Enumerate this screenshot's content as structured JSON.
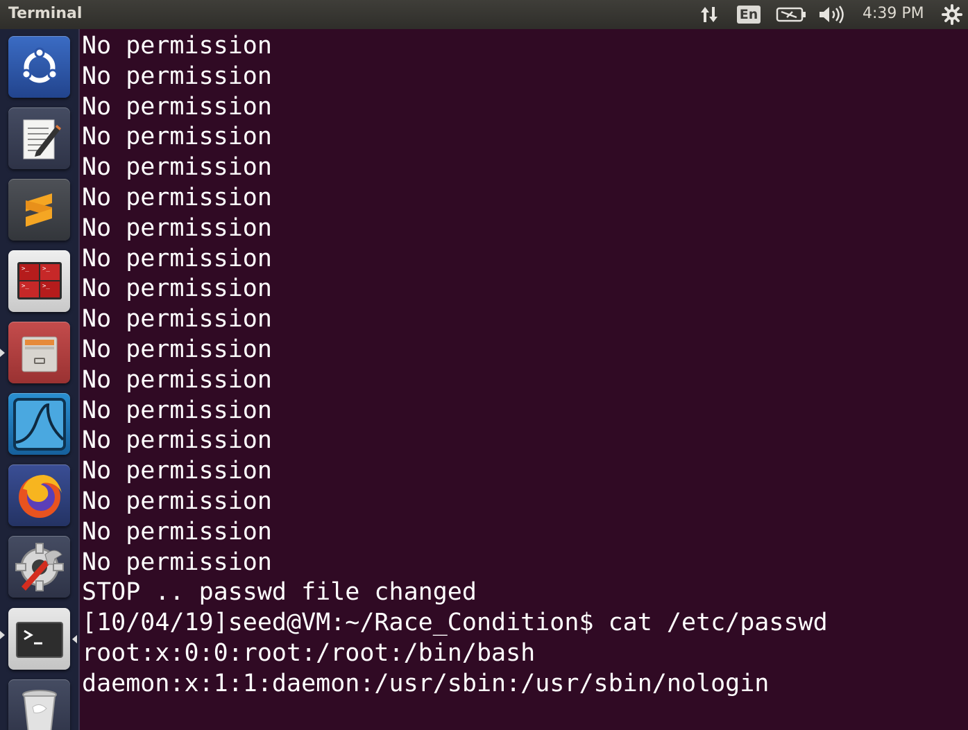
{
  "window": {
    "title": "Terminal"
  },
  "top_panel": {
    "network_icon": "network-updown-icon",
    "keyboard_layout": "En",
    "battery_icon": "battery-charging-icon",
    "sound_icon": "volume-icon",
    "clock": "4:39 PM",
    "system_icon": "gear-icon"
  },
  "launcher": {
    "items": [
      {
        "name": "ubuntu-dash",
        "icon": "ubuntu-logo-icon",
        "color": "#2a4f9a"
      },
      {
        "name": "text-editor",
        "icon": "text-editor-icon",
        "color": "#3a4258"
      },
      {
        "name": "sublime-text",
        "icon": "sublime-text-icon",
        "color": "#3e4146"
      },
      {
        "name": "terminator",
        "icon": "terminator-icon",
        "color": "#3d3d3d"
      },
      {
        "name": "files",
        "icon": "file-cabinet-icon",
        "color": "#b34545"
      },
      {
        "name": "wireshark",
        "icon": "wireshark-fin-icon",
        "color": "#1d6ea8"
      },
      {
        "name": "firefox",
        "icon": "firefox-icon",
        "color": "#2c3e7a"
      },
      {
        "name": "system-settings",
        "icon": "settings-wrench-icon",
        "color": "#3a4258"
      },
      {
        "name": "terminal",
        "icon": "terminal-prompt-icon",
        "color": "#d7d7d7"
      },
      {
        "name": "trash",
        "icon": "trash-icon",
        "color": "#3a4258"
      }
    ]
  },
  "terminal": {
    "background": "#300a24",
    "foreground": "#ffffff",
    "lines": [
      "No permission",
      "No permission",
      "No permission",
      "No permission",
      "No permission",
      "No permission",
      "No permission",
      "No permission",
      "No permission",
      "No permission",
      "No permission",
      "No permission",
      "No permission",
      "No permission",
      "No permission",
      "No permission",
      "No permission",
      "No permission",
      "STOP .. passwd file changed",
      "[10/04/19]seed@VM:~/Race_Condition$ cat /etc/passwd",
      "root:x:0:0:root:/root:/bin/bash",
      "daemon:x:1:1:daemon:/usr/sbin:/usr/sbin/nologin"
    ]
  }
}
